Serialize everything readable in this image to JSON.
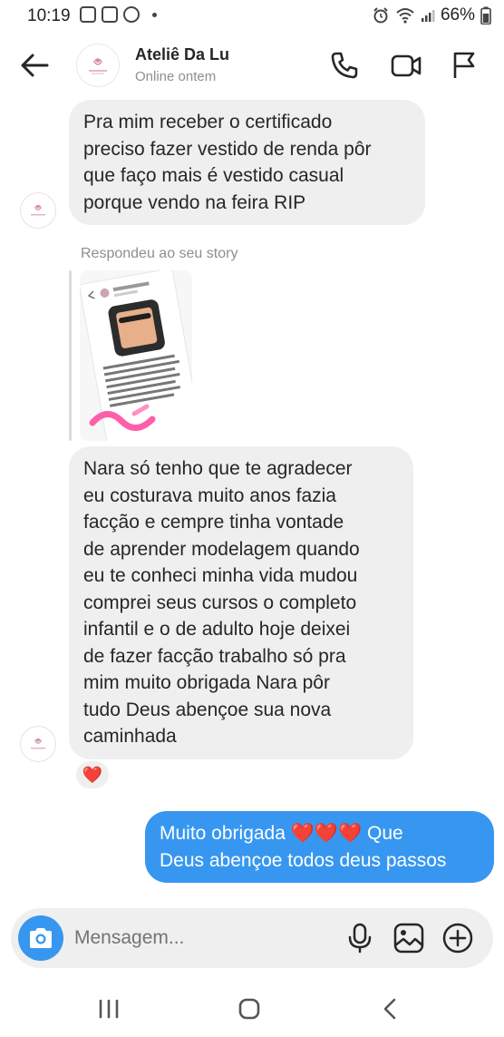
{
  "status_bar": {
    "time": "10:19",
    "battery": "66%"
  },
  "header": {
    "contact_name": "Ateliê Da Lu",
    "contact_status": "Online ontem",
    "avatar_icon": "atelie-logo-icon"
  },
  "messages": [
    {
      "direction": "incoming",
      "text": "Pra mim receber o certificado\npreciso fazer vestido de renda pôr\nque faço mais é vestido casual\nporque vendo na feira RIP"
    },
    {
      "direction": "incoming",
      "type": "story_reply",
      "label": "Respondeu ao seu story",
      "thumbnail_icon": "story-screenshot-thumbnail"
    },
    {
      "direction": "incoming",
      "text": "Nara só tenho que te agradecer\neu costurava muito anos fazia\nfacção e cempre tinha vontade\nde aprender modelagem quando\neu te conheci minha vida mudou\ncomprei seus cursos o completo\ninfantil e o de adulto hoje deixei\nde fazer facção trabalho só pra\nmim muito obrigada Nara pôr\ntudo Deus abençoe sua nova\ncaminhada",
      "reaction": "❤️"
    },
    {
      "direction": "outgoing",
      "text": "Muito obrigada ❤️❤️❤️ Que\nDeus abençoe todos deus passos"
    }
  ],
  "composer": {
    "placeholder": "Mensagem..."
  },
  "colors": {
    "accent": "#3797f0",
    "incoming_bubble": "#efefef",
    "heart": "#e02b3b"
  }
}
